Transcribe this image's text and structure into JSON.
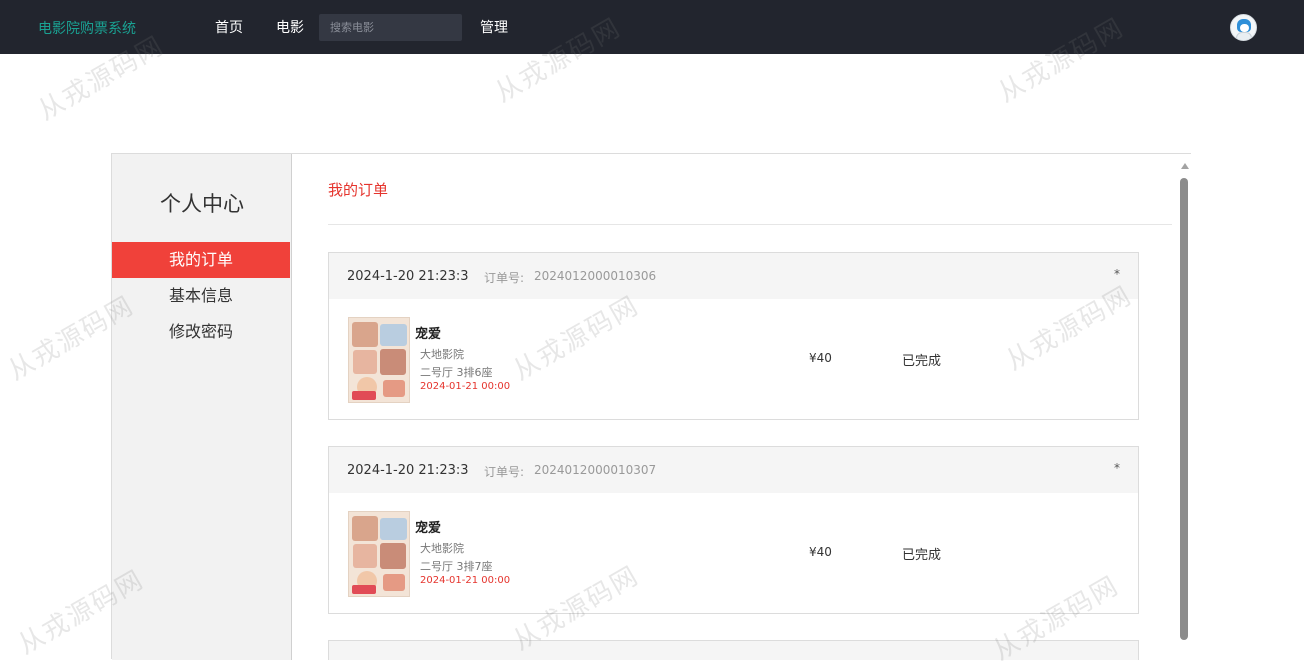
{
  "header": {
    "brand": "电影院购票系统",
    "nav": [
      "首页",
      "电影",
      "管理"
    ],
    "search_placeholder": "搜索电影"
  },
  "watermark": "从戎源码网",
  "sidebar": {
    "title": "个人中心",
    "items": [
      {
        "label": "我的订单",
        "active": true
      },
      {
        "label": "基本信息",
        "active": false
      },
      {
        "label": "修改密码",
        "active": false
      }
    ]
  },
  "main": {
    "title": "我的订单",
    "order_no_label": "订单号:",
    "orders": [
      {
        "date": "2024-1-20 21:23:3",
        "order_no": "2024012000010306",
        "delete": "*",
        "movie": "宠爱",
        "cinema": "大地影院",
        "seat": "二号厅 3排6座",
        "show_time": "2024-01-21 00:00",
        "price": "¥40",
        "status": "已完成"
      },
      {
        "date": "2024-1-20 21:23:3",
        "order_no": "2024012000010307",
        "delete": "*",
        "movie": "宠爱",
        "cinema": "大地影院",
        "seat": "二号厅 3排7座",
        "show_time": "2024-01-21 00:00",
        "price": "¥40",
        "status": "已完成"
      }
    ]
  },
  "colors": {
    "header_bg": "#22252e",
    "brand": "#1aa192",
    "accent": "#f0413a"
  }
}
